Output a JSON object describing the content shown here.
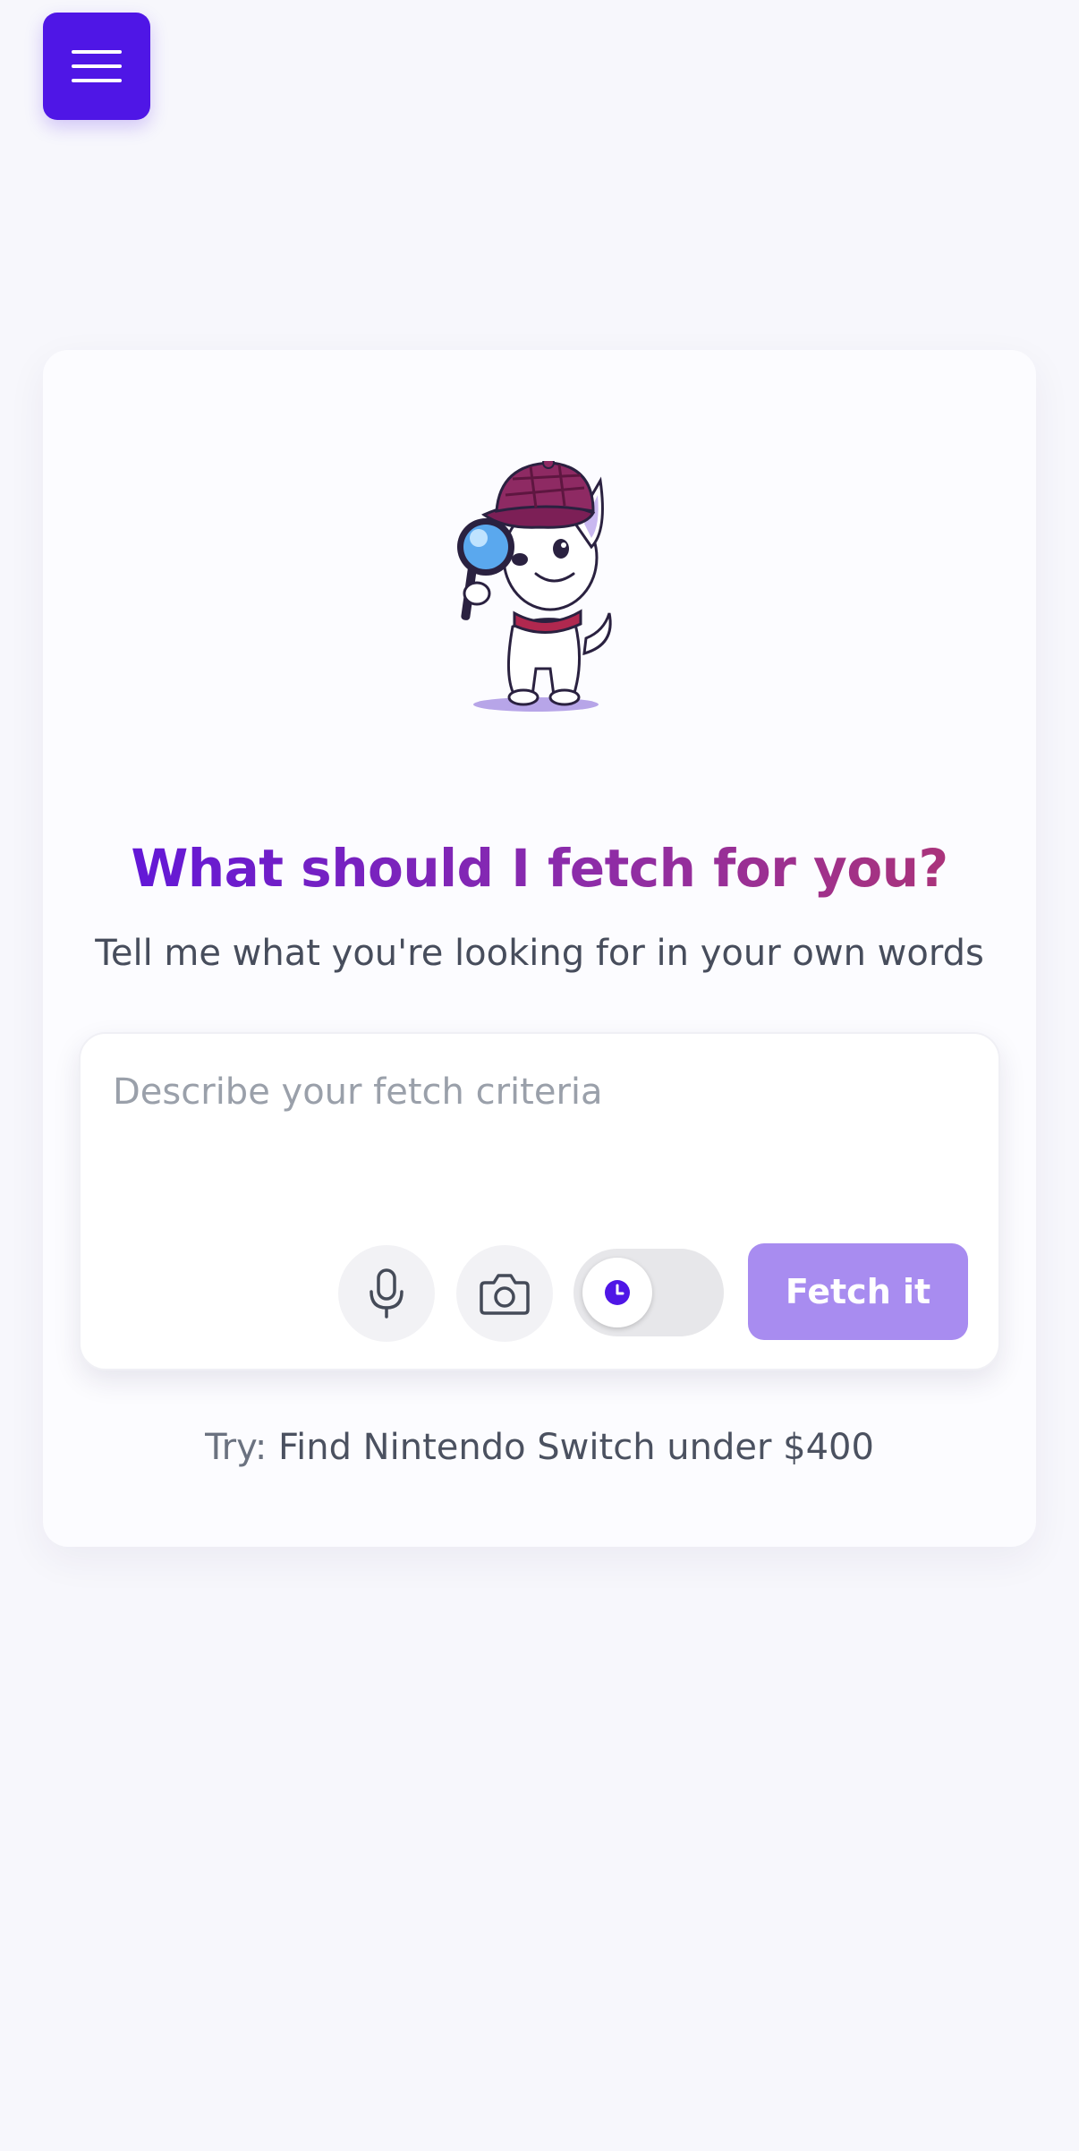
{
  "menu": {
    "icon": "hamburger-menu-icon",
    "color": "#4f16e6"
  },
  "hero": {
    "mascot": "detective-dog-mascot",
    "headline": "What should I fetch for you?",
    "subtitle": "Tell me what you're looking for in your own words"
  },
  "search": {
    "placeholder": "Describe your fetch criteria",
    "value": "",
    "mic_icon": "microphone-icon",
    "camera_icon": "camera-icon",
    "toggle_icon": "clock-icon",
    "toggle_on": false,
    "submit_label": "Fetch it",
    "submit_color": "#a88cf0"
  },
  "suggestion": {
    "prefix": "Try: ",
    "example": "Find Nintendo Switch under $400"
  }
}
